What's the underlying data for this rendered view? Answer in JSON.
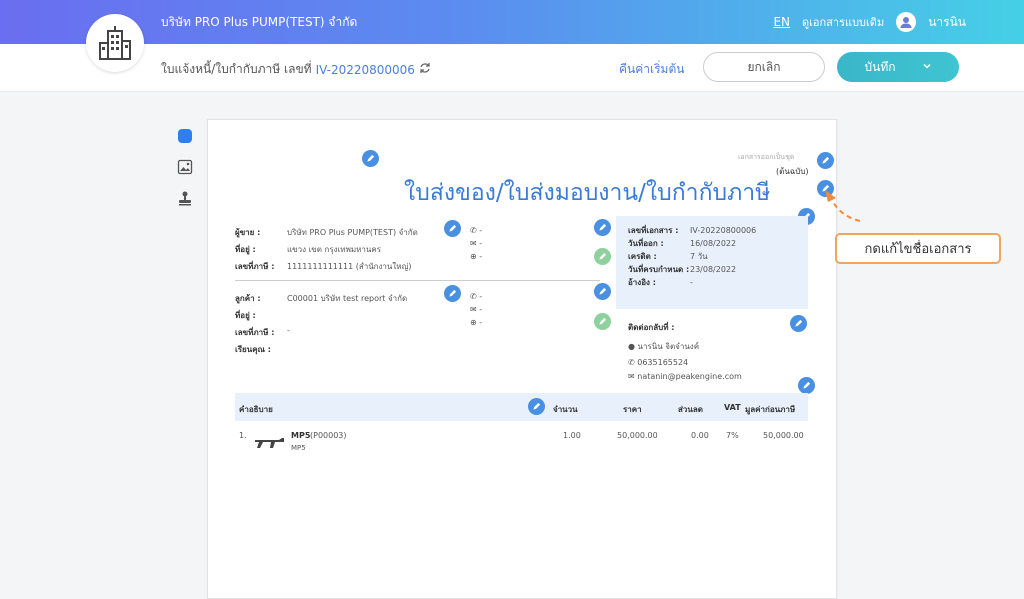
{
  "topbar": {
    "company_name": "บริษัท PRO Plus PUMP(TEST) จำกัด",
    "lang": "EN",
    "classic_view": "ดูเอกสารแบบเดิม",
    "username": "นารนิน"
  },
  "subbar": {
    "doc_type_label": "ใบแจ้งหนี้/ใบกำกับภาษี เลขที่",
    "doc_number": "IV-20220800006",
    "reset_label": "คืนค่าเริ่มต้น",
    "cancel_label": "ยกเลิก",
    "save_label": "บันทึก"
  },
  "document": {
    "copy_type": "เอกสารออกเป็นชุด",
    "original_label": "(ต้นฉบับ)",
    "title": "ใบส่งของ/ใบส่งมอบงาน/ใบกำกับภาษี",
    "seller": {
      "name_label": "ผู้ขาย :",
      "name": "บริษัท PRO Plus PUMP(TEST) จำกัด",
      "address_label": "ที่อยู่ :",
      "address": "แขวง เขต กรุงเทพมหานคร",
      "tax_label": "เลขที่ภาษี :",
      "tax_id": "1111111111111 (สำนักงานใหญ่)",
      "phone": "-",
      "email": "-",
      "web": "-"
    },
    "customer": {
      "name_label": "ลูกค้า :",
      "name": "C00001 บริษัท test report จำกัด",
      "address_label": "ที่อยู่ :",
      "address": "",
      "tax_label": "เลขที่ภาษี :",
      "tax_id": "-",
      "attn_label": "เรียนคุณ :",
      "attn": "",
      "phone": "-",
      "email": "-",
      "web": "-"
    },
    "info": {
      "doc_no_label": "เลขที่เอกสาร :",
      "doc_no": "IV-20220800006",
      "issue_label": "วันที่ออก :",
      "issue_date": "16/08/2022",
      "credit_label": "เครดิต :",
      "credit": "7 วัน",
      "due_label": "วันที่ครบกำหนด :",
      "due_date": "23/08/2022",
      "ref_label": "อ้างอิง :",
      "ref": "-"
    },
    "contact": {
      "label": "ติดต่อกลับที่ :",
      "name": "นารนิน จิตจำนงค์",
      "phone": "0635165524",
      "email": "natanin@peakengine.com"
    },
    "table": {
      "headers": [
        "คำอธิบาย",
        "จำนวน",
        "ราคา",
        "ส่วนลด",
        "VAT",
        "มูลค่าก่อนภาษี"
      ],
      "rows": [
        {
          "no": "1.",
          "name": "MP5",
          "code": "(P00003)",
          "desc": "MP5",
          "qty": "1.00",
          "price": "50,000.00",
          "discount": "0.00",
          "vat": "7%",
          "amount": "50,000.00"
        }
      ]
    }
  },
  "annotation": {
    "text": "กดแก้ไขชื่อเอกสาร"
  },
  "colors": {
    "accent": "#4a90e2",
    "title_blue": "#3a7bd5",
    "save_button": "#3fc4d2",
    "annotation_border": "#f0a45c"
  }
}
